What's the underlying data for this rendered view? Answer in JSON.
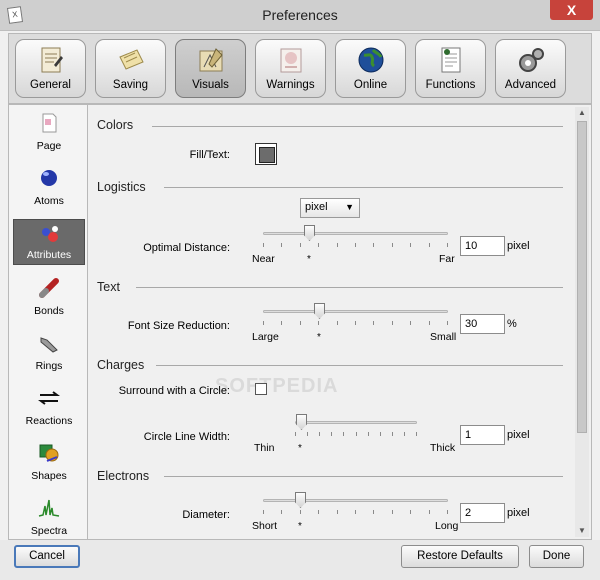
{
  "window": {
    "title": "Preferences",
    "close_glyph": "X",
    "app_icon_glyph": "X",
    "app_icon": "app-logo-icon"
  },
  "tabs": [
    {
      "label": "General",
      "icon": "general-icon"
    },
    {
      "label": "Saving",
      "icon": "saving-icon"
    },
    {
      "label": "Visuals",
      "icon": "visuals-icon",
      "active": true
    },
    {
      "label": "Warnings",
      "icon": "warnings-icon"
    },
    {
      "label": "Online",
      "icon": "globe-icon"
    },
    {
      "label": "Functions",
      "icon": "functions-icon"
    },
    {
      "label": "Advanced",
      "icon": "advanced-icon"
    }
  ],
  "sidebar": [
    {
      "label": "Page",
      "icon": "page-icon"
    },
    {
      "label": "Atoms",
      "icon": "atoms-icon"
    },
    {
      "label": "Attributes",
      "icon": "attributes-icon",
      "active": true
    },
    {
      "label": "Bonds",
      "icon": "bonds-icon"
    },
    {
      "label": "Rings",
      "icon": "rings-icon"
    },
    {
      "label": "Reactions",
      "icon": "reactions-icon"
    },
    {
      "label": "Shapes",
      "icon": "shapes-icon"
    },
    {
      "label": "Spectra",
      "icon": "spectra-icon"
    }
  ],
  "colors": {
    "heading": "Colors",
    "fill_text_label": "Fill/Text:",
    "fill_color": "#6c6c6c"
  },
  "logistics": {
    "heading": "Logistics",
    "unit_select": "pixel",
    "optimal_distance": {
      "label": "Optimal Distance:",
      "min_label": "Near",
      "max_label": "Far",
      "default_marker": "*",
      "value": "10",
      "unit": "pixel",
      "slider_fraction": 0.25
    }
  },
  "text": {
    "heading": "Text",
    "font_size_reduction": {
      "label": "Font Size Reduction:",
      "min_label": "Large",
      "max_label": "Small",
      "default_marker": "*",
      "value": "30",
      "unit": "%",
      "slider_fraction": 0.3
    }
  },
  "charges": {
    "heading": "Charges",
    "surround_label": "Surround with a Circle:",
    "surround_checked": false,
    "circle_line_width": {
      "label": "Circle Line Width:",
      "min_label": "Thin",
      "max_label": "Thick",
      "default_marker": "*",
      "value": "1",
      "unit": "pixel",
      "slider_fraction": 0.05
    }
  },
  "electrons": {
    "heading": "Electrons",
    "diameter": {
      "label": "Diameter:",
      "min_label": "Short",
      "max_label": "Long",
      "default_marker": "*",
      "value": "2",
      "unit": "pixel",
      "slider_fraction": 0.2
    }
  },
  "watermark": "SOFTPEDIA",
  "buttons": {
    "cancel": "Cancel",
    "restore": "Restore Defaults",
    "done": "Done"
  },
  "scrollbar": {
    "up_glyph": "▲",
    "down_glyph": "▼"
  }
}
